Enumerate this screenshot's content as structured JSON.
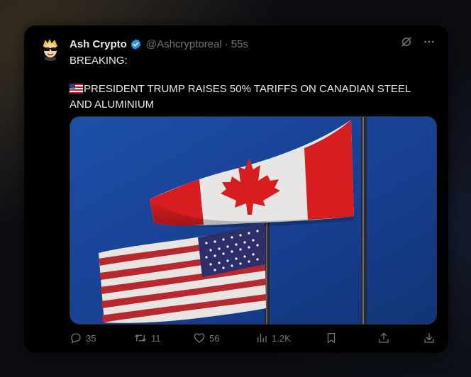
{
  "tweet": {
    "author_name": "Ash Crypto",
    "handle": "@Ashcryptoreal",
    "separator": "·",
    "time": "55s",
    "line1": "BREAKING:",
    "line2": "PRESIDENT TRUMP RAISES 50% TARIFFS ON CANADIAN STEEL AND ALUMINIUM",
    "flag_emoji": "us-flag-emoji",
    "image": "photo of Canadian flag flying above US flag"
  },
  "actions": {
    "replies": "35",
    "reposts": "11",
    "likes": "56",
    "views": "1.2K"
  },
  "icons": [
    "grok-icon",
    "more-icon",
    "reply-icon",
    "repost-icon",
    "like-icon",
    "views-icon",
    "bookmark-icon",
    "share-icon",
    "download-icon"
  ],
  "colors": {
    "background": "#000000",
    "text": "#e7e9ea",
    "muted": "#71767b",
    "verified": "#1d9bf0"
  }
}
